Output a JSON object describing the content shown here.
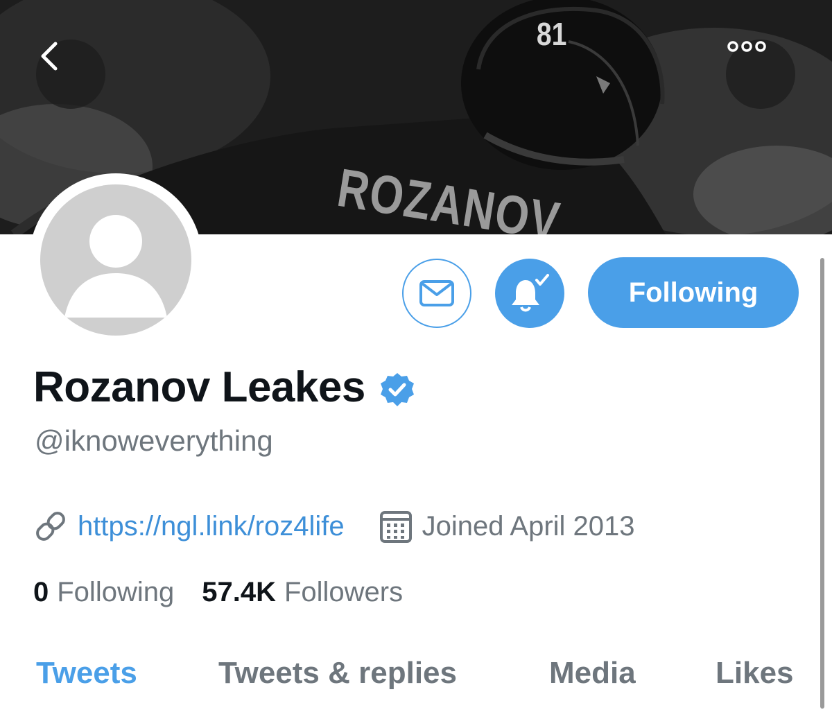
{
  "header": {
    "jersey_number": "81",
    "jersey_name": "ROZANOV",
    "back_icon": "chevron-left-icon",
    "more_icon": "ellipsis-icon"
  },
  "actions": {
    "message_icon": "envelope-icon",
    "notify_icon": "bell-check-icon",
    "following_label": "Following"
  },
  "profile": {
    "display_name": "Rozanov Leakes",
    "verified_icon": "verified-badge-icon",
    "handle": "@iknoweverything",
    "link": "https://ngl.link/roz4life",
    "link_icon": "link-icon",
    "calendar_icon": "calendar-icon",
    "joined": "Joined April 2013"
  },
  "stats": {
    "following_count": "0",
    "following_label": "Following",
    "followers_count": "57.4K",
    "followers_label": "Followers"
  },
  "tabs": [
    {
      "label": "Tweets",
      "active": true
    },
    {
      "label": "Tweets & replies",
      "active": false
    },
    {
      "label": "Media",
      "active": false
    },
    {
      "label": "Likes",
      "active": false
    }
  ],
  "colors": {
    "accent": "#4a9fe8",
    "link": "#3d8fd8",
    "text": "#0f1419",
    "muted": "#6e767d"
  }
}
